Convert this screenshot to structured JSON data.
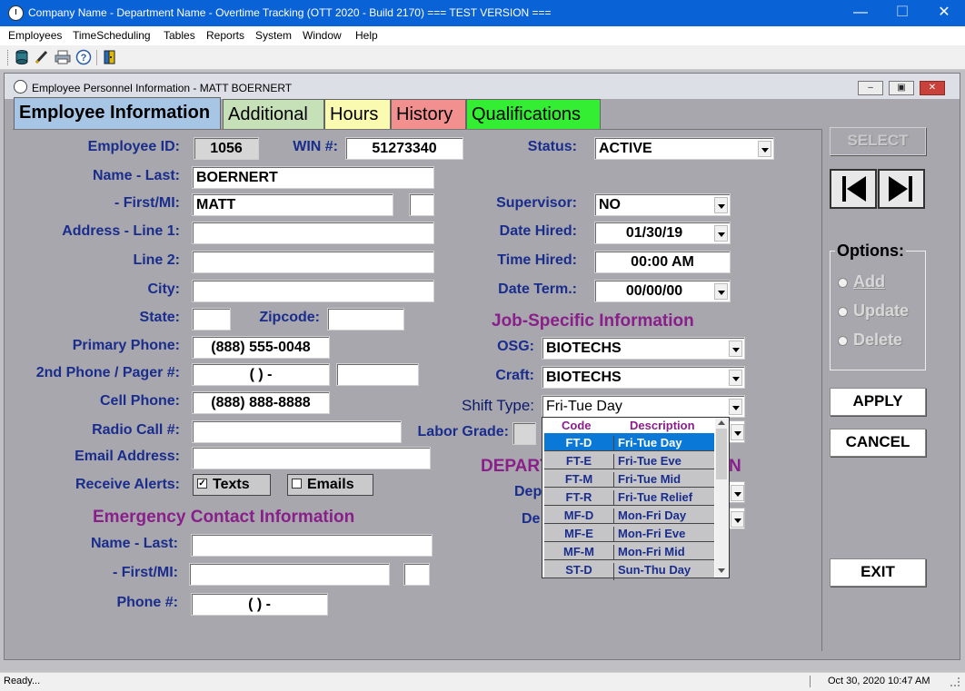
{
  "window": {
    "title": "Company Name - Department Name - Overtime Tracking (OTT 2020 - Build 2170) === TEST VERSION ===",
    "minimize": "—",
    "maximize": "☐",
    "close": "✕"
  },
  "menu": [
    "Employees",
    "TimeScheduling",
    "Tables",
    "Reports",
    "System",
    "Window",
    "Help"
  ],
  "child": {
    "title": "Employee Personnel Information - MATT BOERNERT",
    "min": "–",
    "max": "▣",
    "close": "✕"
  },
  "tabs": [
    {
      "label": "Employee Information"
    },
    {
      "label": "Additional"
    },
    {
      "label": "Hours"
    },
    {
      "label": "History"
    },
    {
      "label": "Qualifications"
    }
  ],
  "form": {
    "employee_id_label": "Employee ID:",
    "employee_id": "1056",
    "win_label": "WIN #:",
    "win": "51273340",
    "status_label": "Status:",
    "status": "ACTIVE",
    "name_last_label": "Name - Last:",
    "name_last": "BOERNERT",
    "first_mi_label": "- First/MI:",
    "first": "MATT",
    "mi": "",
    "address1_label": "Address - Line 1:",
    "address1": "",
    "line2_label": "Line 2:",
    "line2": "",
    "city_label": "City:",
    "city": "",
    "state_label": "State:",
    "state": "",
    "zip_label": "Zipcode:",
    "zip": "",
    "primary_phone_label": "Primary Phone:",
    "primary_phone": "(888) 555-0048",
    "phone2_label": "2nd Phone / Pager #:",
    "phone2": "(   )    -",
    "phone2_ext": "",
    "cell_label": "Cell Phone:",
    "cell": "(888) 888-8888",
    "radio_label": "Radio Call #:",
    "radio": "",
    "email_label": "Email Address:",
    "email": "",
    "alerts_label": "Receive Alerts:",
    "texts_label": "Texts",
    "emails_label": "Emails",
    "texts_checked": "✓",
    "supervisor_label": "Supervisor:",
    "supervisor": "NO",
    "date_hired_label": "Date Hired:",
    "date_hired": "01/30/19",
    "time_hired_label": "Time Hired:",
    "time_hired": "00:00 AM",
    "date_term_label": "Date Term.:",
    "date_term": "00/00/00",
    "job_section": "Job-Specific  Information",
    "osg_label": "OSG:",
    "osg": "BIOTECHS",
    "craft_label": "Craft:",
    "craft": "BIOTECHS",
    "shift_type_label": "Shift Type:",
    "shift_type": "Fri-Tue Day",
    "labor_grade_label": "Labor Grade:",
    "dept_section_partial_left": "DEPART",
    "dept_section_partial_right": "N",
    "dep_label_partial": "Dep",
    "de_label_partial": "De"
  },
  "emergency": {
    "section": "Emergency Contact Information",
    "name_last_label": "Name - Last:",
    "name_last": "",
    "first_mi_label": "- First/MI:",
    "first": "",
    "mi": "",
    "phone_label": "Phone #:",
    "phone": "(   )    -"
  },
  "shift_dropdown": {
    "code_header": "Code",
    "desc_header": "Description",
    "rows": [
      {
        "code": "FT-D",
        "desc": "Fri-Tue Day"
      },
      {
        "code": "FT-E",
        "desc": "Fri-Tue Eve"
      },
      {
        "code": "FT-M",
        "desc": "Fri-Tue Mid"
      },
      {
        "code": "FT-R",
        "desc": "Fri-Tue Relief"
      },
      {
        "code": "MF-D",
        "desc": "Mon-Fri Day"
      },
      {
        "code": "MF-E",
        "desc": "Mon-Fri Eve"
      },
      {
        "code": "MF-M",
        "desc": "Mon-Fri Mid"
      },
      {
        "code": "ST-D",
        "desc": "Sun-Thu Day"
      }
    ]
  },
  "actions": {
    "select": "SELECT",
    "options_label": "Options:",
    "add": "Add",
    "update": "Update",
    "delete": "Delete",
    "apply": "APPLY",
    "cancel": "CANCEL",
    "exit": "EXIT"
  },
  "status": {
    "text": "Ready...",
    "datetime": "Oct 30, 2020  10:47 AM"
  },
  "colors": {
    "titlebar": "#0a63d6",
    "label": "#1a2d8c",
    "section": "#8a1e8a",
    "selected_row": "#0a78d7"
  }
}
